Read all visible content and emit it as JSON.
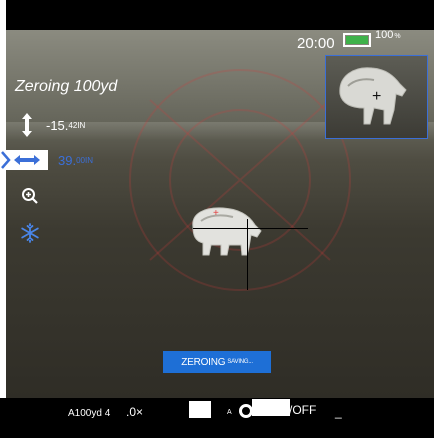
{
  "status": {
    "time": "20:00",
    "battery_percent": "100",
    "battery_unit": "%",
    "battery_level": 1.0
  },
  "zeroing": {
    "title": "Zeroing 100yd",
    "vertical_value": "-15.",
    "vertical_unit": "42IN",
    "horizontal_value": "39.",
    "horizontal_unit": "00IN"
  },
  "saving_toast": {
    "label": "ZEROING",
    "label_small": "SAVING..."
  },
  "bottom": {
    "ammo_profile": "A100yd 4",
    "zoom": ".0×",
    "mode_letter": "A",
    "toggle_state": "/OFF",
    "dash": "_"
  },
  "icons": [
    "vertical-arrows-icon",
    "horizontal-arrows-icon",
    "zoom-icon",
    "snowflake-icon",
    "crosshair-icon"
  ],
  "colors": {
    "accent_blue": "#3b6fd8",
    "battery_green": "#3fb24a",
    "toast_blue": "#1e6fd6"
  }
}
